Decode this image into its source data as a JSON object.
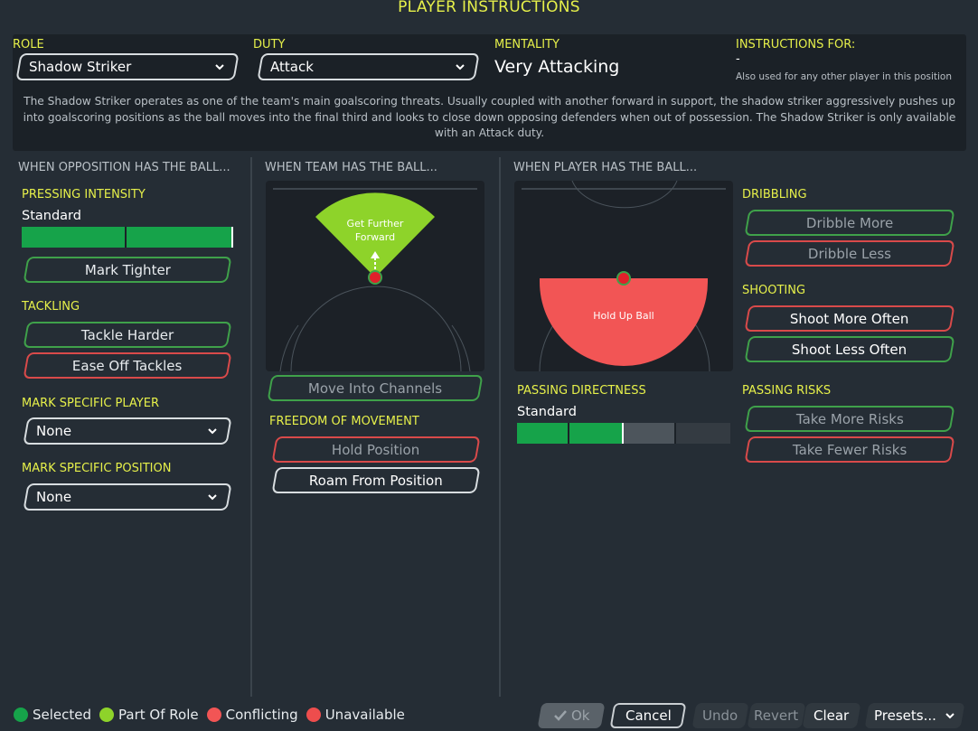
{
  "window": {
    "title": "PLAYER INSTRUCTIONS"
  },
  "header": {
    "role": {
      "label": "ROLE",
      "value": "Shadow Striker"
    },
    "duty": {
      "label": "DUTY",
      "value": "Attack"
    },
    "mentality": {
      "label": "MENTALITY",
      "value": "Very Attacking"
    },
    "instructions_for": {
      "label": "INSTRUCTIONS FOR:",
      "value": "-",
      "note": "Also used for any other player in this position"
    },
    "description": "The Shadow Striker operates as one of the team's main goalscoring threats. Usually coupled with another forward in support, the shadow striker aggressively pushes up into goalscoring positions as the ball moves into the final third and looks to close down opposing defenders when out of possession. The Shadow Striker is only available with an Attack duty."
  },
  "opposition": {
    "heading": "WHEN OPPOSITION HAS THE BALL...",
    "pressing": {
      "label": "PRESSING INTENSITY",
      "value": "Standard",
      "level_fraction": 1.0
    },
    "mark_tighter": "Mark Tighter",
    "tackling": {
      "label": "TACKLING",
      "harder": "Tackle Harder",
      "ease_off": "Ease Off Tackles"
    },
    "mark_player": {
      "label": "MARK SPECIFIC PLAYER",
      "value": "None"
    },
    "mark_position": {
      "label": "MARK SPECIFIC POSITION",
      "value": "None"
    }
  },
  "team": {
    "heading": "WHEN TEAM HAS THE BALL...",
    "pitch_label": "Get Further Forward",
    "move_channels": "Move Into Channels",
    "freedom": {
      "label": "FREEDOM OF MOVEMENT",
      "hold": "Hold Position",
      "roam": "Roam From Position"
    }
  },
  "player": {
    "heading": "WHEN PLAYER HAS THE BALL...",
    "pitch_label": "Hold Up Ball",
    "passing_directness": {
      "label": "PASSING DIRECTNESS",
      "value": "Standard",
      "level_fraction": 0.5
    },
    "dribbling": {
      "label": "DRIBBLING",
      "more": "Dribble More",
      "less": "Dribble Less"
    },
    "shooting": {
      "label": "SHOOTING",
      "more": "Shoot More Often",
      "less": "Shoot Less Often"
    },
    "passing_risks": {
      "label": "PASSING RISKS",
      "more": "Take More Risks",
      "fewer": "Take Fewer Risks"
    }
  },
  "footer": {
    "legend": {
      "selected": "Selected",
      "part_of_role": "Part Of Role",
      "conflicting": "Conflicting",
      "unavailable": "Unavailable"
    },
    "ok": "Ok",
    "cancel": "Cancel",
    "undo": "Undo",
    "revert": "Revert",
    "clear": "Clear",
    "presets": "Presets..."
  },
  "colors": {
    "accent_yellow": "#e6f04a",
    "selected_green": "#16a34a",
    "part_of_role_green": "#8ed32a",
    "conflicting_red": "#f25555",
    "unavailable_red": "#ee4d4d"
  }
}
